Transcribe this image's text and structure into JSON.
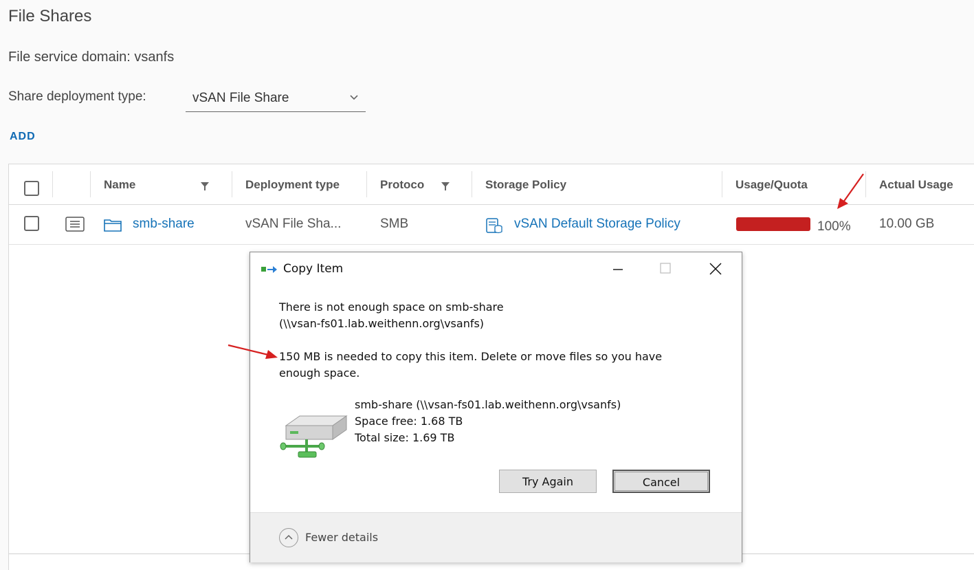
{
  "page": {
    "title": "File Shares",
    "domain_label": "File service domain: vsanfs",
    "deployment_label": "Share deployment type:",
    "deployment_value": "vSAN File Share",
    "add_label": "ADD"
  },
  "grid": {
    "columns": [
      "Name",
      "Deployment type",
      "Protoco",
      "Storage Policy",
      "Usage/Quota",
      "Actual Usage"
    ],
    "rows": [
      {
        "name": "smb-share",
        "deployment_type": "vSAN File Sha...",
        "protocol": "SMB",
        "storage_policy": "vSAN Default Storage Policy",
        "usage_percent": "100%",
        "usage_fraction": 1.0,
        "actual_usage": "10.00 GB"
      }
    ]
  },
  "dialog": {
    "title": "Copy Item",
    "message1_line1": "There is not enough space on smb-share",
    "message1_line2": "(\\\\vsan-fs01.lab.weithenn.org\\vsanfs)",
    "message2_line1": "150 MB is needed to copy this item. Delete or move files so you have",
    "message2_line2": "enough space.",
    "drive_name": "smb-share (\\\\vsan-fs01.lab.weithenn.org\\vsanfs)",
    "space_free": "Space free: 1.68 TB",
    "total_size": "Total size: 1.69 TB",
    "try_again_label": "Try Again",
    "cancel_label": "Cancel",
    "fewer_details_label": "Fewer details"
  },
  "colors": {
    "link": "#1673b8",
    "usage_bar": "#c42020",
    "annotation_arrow": "#d62020"
  }
}
